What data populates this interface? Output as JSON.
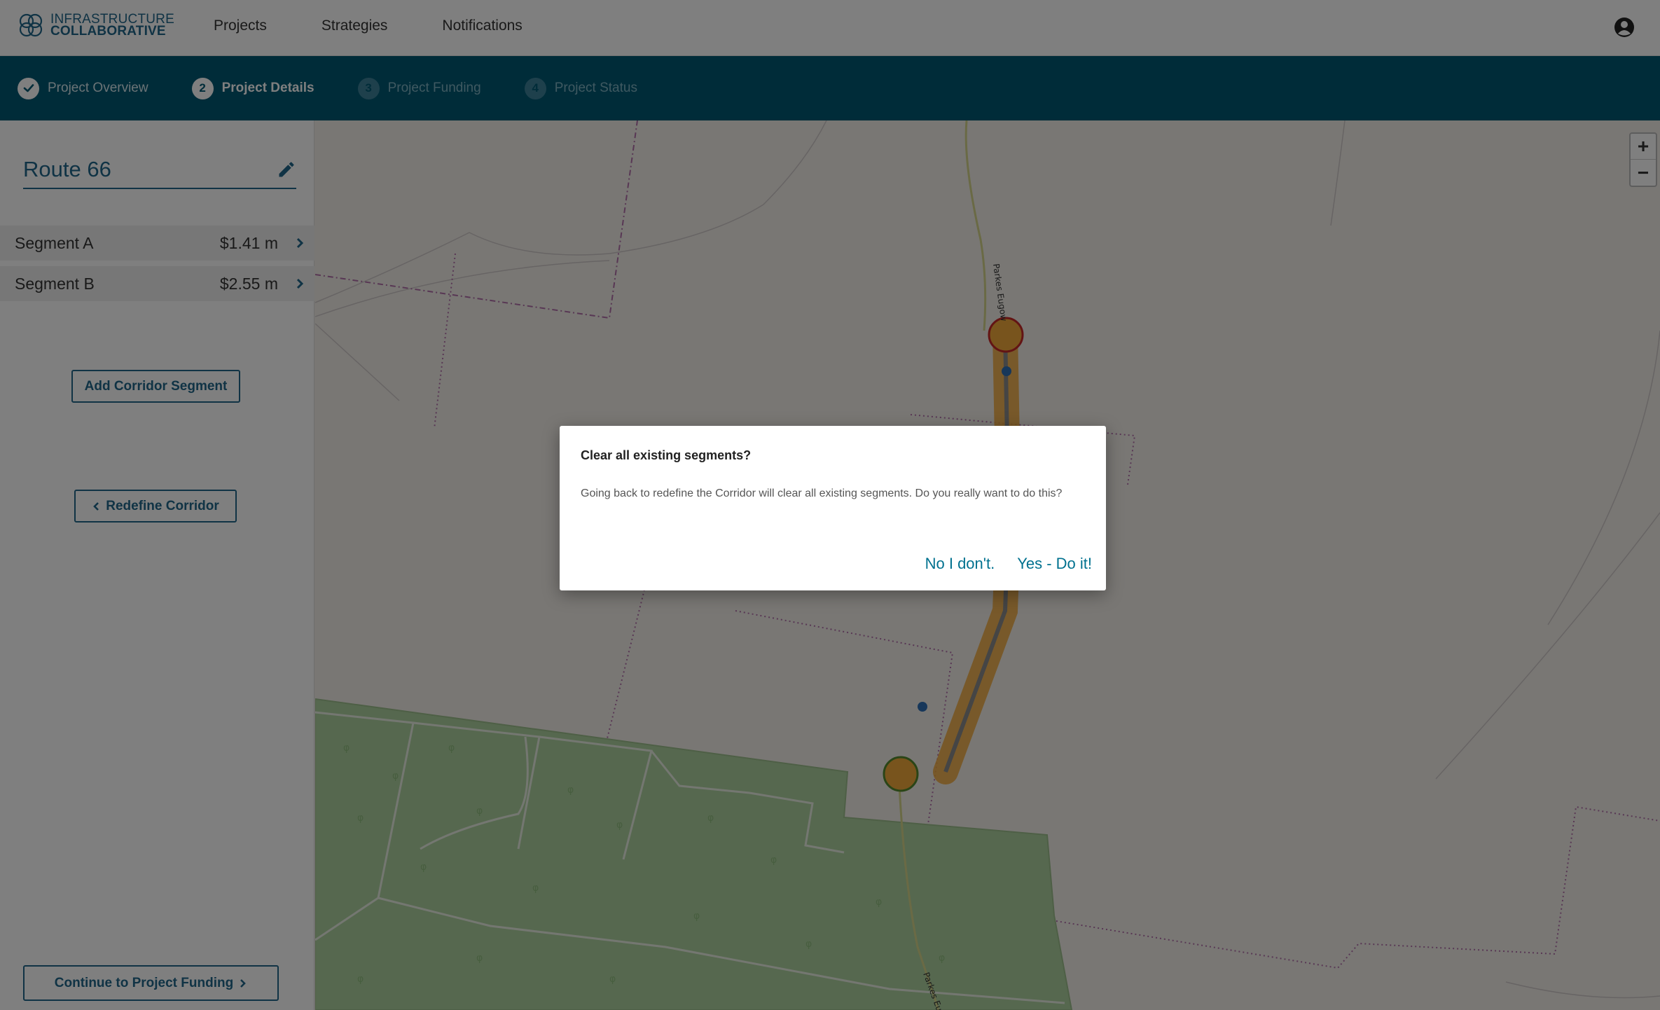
{
  "header": {
    "logo": {
      "line1": "INFRASTRUCTURE",
      "line2": "COLLABORATIVE"
    },
    "nav": [
      "Projects",
      "Strategies",
      "Notifications"
    ],
    "account_icon": "account-circle-icon"
  },
  "stepper": {
    "steps": [
      {
        "number": "",
        "label": "Project Overview",
        "state": "done",
        "icon": "check-icon"
      },
      {
        "number": "2",
        "label": "Project Details",
        "state": "active"
      },
      {
        "number": "3",
        "label": "Project Funding",
        "state": "pending"
      },
      {
        "number": "4",
        "label": "Project Status",
        "state": "pending"
      }
    ]
  },
  "sidebar": {
    "project_name": "Route 66",
    "edit_icon": "pencil-icon",
    "segments": [
      {
        "name": "Segment A",
        "amount": "$1.41 m"
      },
      {
        "name": "Segment B",
        "amount": "$2.55 m"
      }
    ],
    "add_segment_label": "Add Corridor Segment",
    "redefine_label": "Redefine Corridor",
    "continue_label": "Continue to Project Funding"
  },
  "map": {
    "zoom_in": "+",
    "zoom_out": "−",
    "road_label_top": "Parkes Eugow",
    "road_label_bottom": "Parkes Eug",
    "colors": {
      "corridor": "#f0a83a",
      "marker_start": "#c62828",
      "marker_end": "#558b2f",
      "forest": "#add19e",
      "boundary": "#b06fa8"
    }
  },
  "dialog": {
    "title": "Clear all existing segments?",
    "message": "Going back to redefine the Corridor will clear all existing segments. Do you really want to do this?",
    "cancel_label": "No I don't.",
    "confirm_label": "Yes - Do it!"
  },
  "colors": {
    "primary": "#005872",
    "accent": "#20678a",
    "link": "#00718f"
  }
}
